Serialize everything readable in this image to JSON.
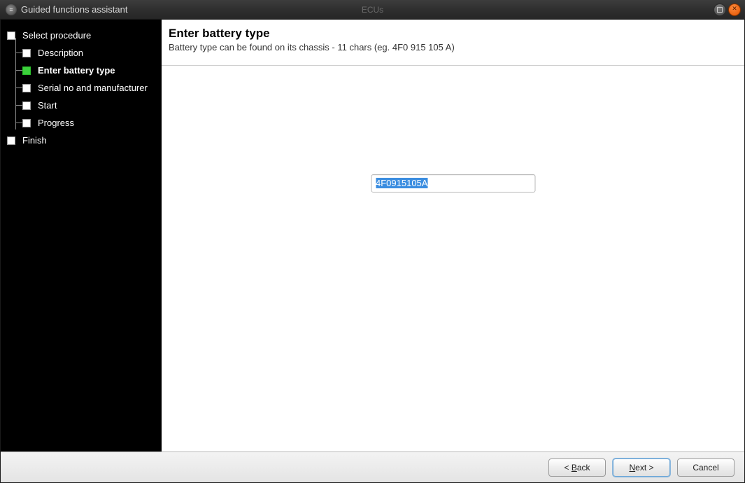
{
  "window": {
    "title": "Guided functions assistant",
    "background_tab": "ECUs"
  },
  "sidebar": {
    "steps": [
      {
        "label": "Select procedure",
        "level": "root",
        "active": false
      },
      {
        "label": "Description",
        "level": "child",
        "active": false
      },
      {
        "label": "Enter battery type",
        "level": "child",
        "active": true
      },
      {
        "label": "Serial no and manufacturer",
        "level": "child",
        "active": false
      },
      {
        "label": "Start",
        "level": "child",
        "active": false
      },
      {
        "label": "Progress",
        "level": "child",
        "active": false
      },
      {
        "label": "Finish",
        "level": "root",
        "active": false
      }
    ]
  },
  "content": {
    "title": "Enter battery type",
    "subtitle": "Battery type can be found on its chassis - 11 chars (eg. 4F0 915 105 A)",
    "input_value": "4F0915105A"
  },
  "footer": {
    "back_prefix": "< ",
    "back_ul": "B",
    "back_rest": "ack",
    "next_ul": "N",
    "next_rest": "ext >",
    "cancel": "Cancel"
  }
}
